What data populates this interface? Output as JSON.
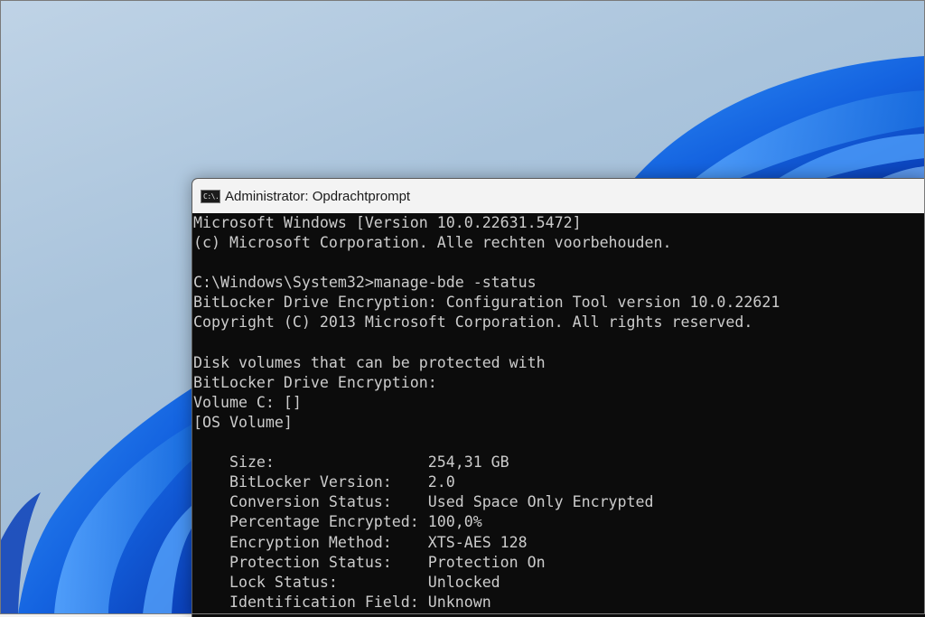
{
  "window": {
    "title": "Administrator: Opdrachtprompt",
    "icon_glyph": "C:\\."
  },
  "console": {
    "lines": [
      "Microsoft Windows [Version 10.0.22631.5472]",
      "(c) Microsoft Corporation. Alle rechten voorbehouden.",
      "",
      "C:\\Windows\\System32>manage-bde -status",
      "BitLocker Drive Encryption: Configuration Tool version 10.0.22621",
      "Copyright (C) 2013 Microsoft Corporation. All rights reserved.",
      "",
      "Disk volumes that can be protected with",
      "BitLocker Drive Encryption:",
      "Volume C: []",
      "[OS Volume]",
      "",
      "    Size:                 254,31 GB",
      "    BitLocker Version:    2.0",
      "    Conversion Status:    Used Space Only Encrypted",
      "    Percentage Encrypted: 100,0%",
      "    Encryption Method:    XTS-AES 128",
      "    Protection Status:    Protection On",
      "    Lock Status:          Unlocked",
      "    Identification Field: Unknown"
    ]
  },
  "colors": {
    "console_background": "#0c0c0c",
    "console_text": "#cccccc",
    "titlebar": "#f3f3f3",
    "wallpaper_bloom": "#1a6fe0"
  },
  "icons": {
    "window_icon": "command-prompt-icon"
  }
}
